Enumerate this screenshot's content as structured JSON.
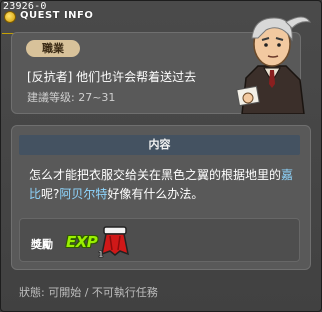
{
  "header": {
    "quest_id": "23926-0",
    "title": "QUEST INFO"
  },
  "summary": {
    "job_label": "職業",
    "quest_name": "[反抗者] 他们也许会帮着送过去",
    "level_req": "建議等级: 27~31"
  },
  "content": {
    "header": "内容",
    "text_parts": {
      "p1": "怎么才能把衣服交给关在黑色之翼的根据地里的",
      "p2": "嘉比",
      "p3": "呢?",
      "p4": "阿贝尔特",
      "p5": "好像有什么办法。"
    }
  },
  "reward": {
    "label": "獎勵",
    "exp_icon_text": "EXP",
    "item_count": "1"
  },
  "status": {
    "text": "狀態: 可開始 / 不可執行任務"
  },
  "colors": {
    "highlight_npc": "#8fd6ff",
    "title_accent": "#caa400",
    "exp_green": "#9af000"
  },
  "icons": {
    "npc_portrait": "npc-portrait",
    "exp": "exp-icon",
    "reward_item": "red-cape-icon"
  }
}
